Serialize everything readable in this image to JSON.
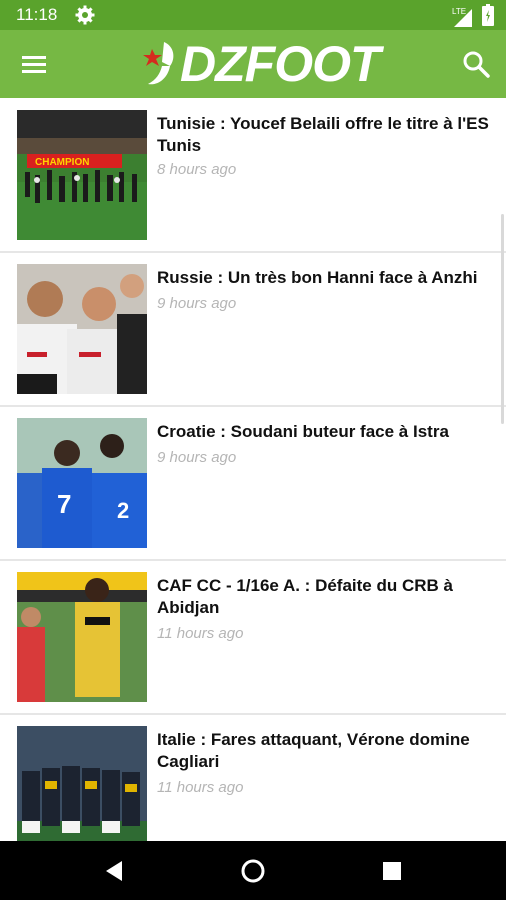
{
  "status_bar": {
    "time": "11:18",
    "network_label": "LTE",
    "gear_icon": "gear-icon",
    "signal_icon": "signal-icon",
    "battery_icon": "battery-icon"
  },
  "app_bar": {
    "logo_text": "DZFOOT",
    "menu_icon": "hamburger-menu-icon",
    "search_icon": "search-icon",
    "brand_color": "#76b844",
    "status_color": "#5aa32c"
  },
  "articles": [
    {
      "title": "Tunisie : Youcef Belaili offre le titre à l'ES Tunis",
      "time": "8 hours ago",
      "banner": "CHAMPION"
    },
    {
      "title": "Russie : Un très bon Hanni face à Anzhi",
      "time": "9 hours ago"
    },
    {
      "title": "Croatie : Soudani buteur face à Istra",
      "time": "9 hours ago",
      "jersey_numbers": [
        "7",
        "2"
      ]
    },
    {
      "title": "CAF CC - 1/16e A. : Défaite du CRB à Abidjan",
      "time": "11 hours ago"
    },
    {
      "title": "Italie : Fares attaquant, Vérone domine Cagliari",
      "time": "11 hours ago"
    }
  ],
  "nav": {
    "back": "back-icon",
    "home": "home-icon",
    "recents": "recents-icon"
  }
}
